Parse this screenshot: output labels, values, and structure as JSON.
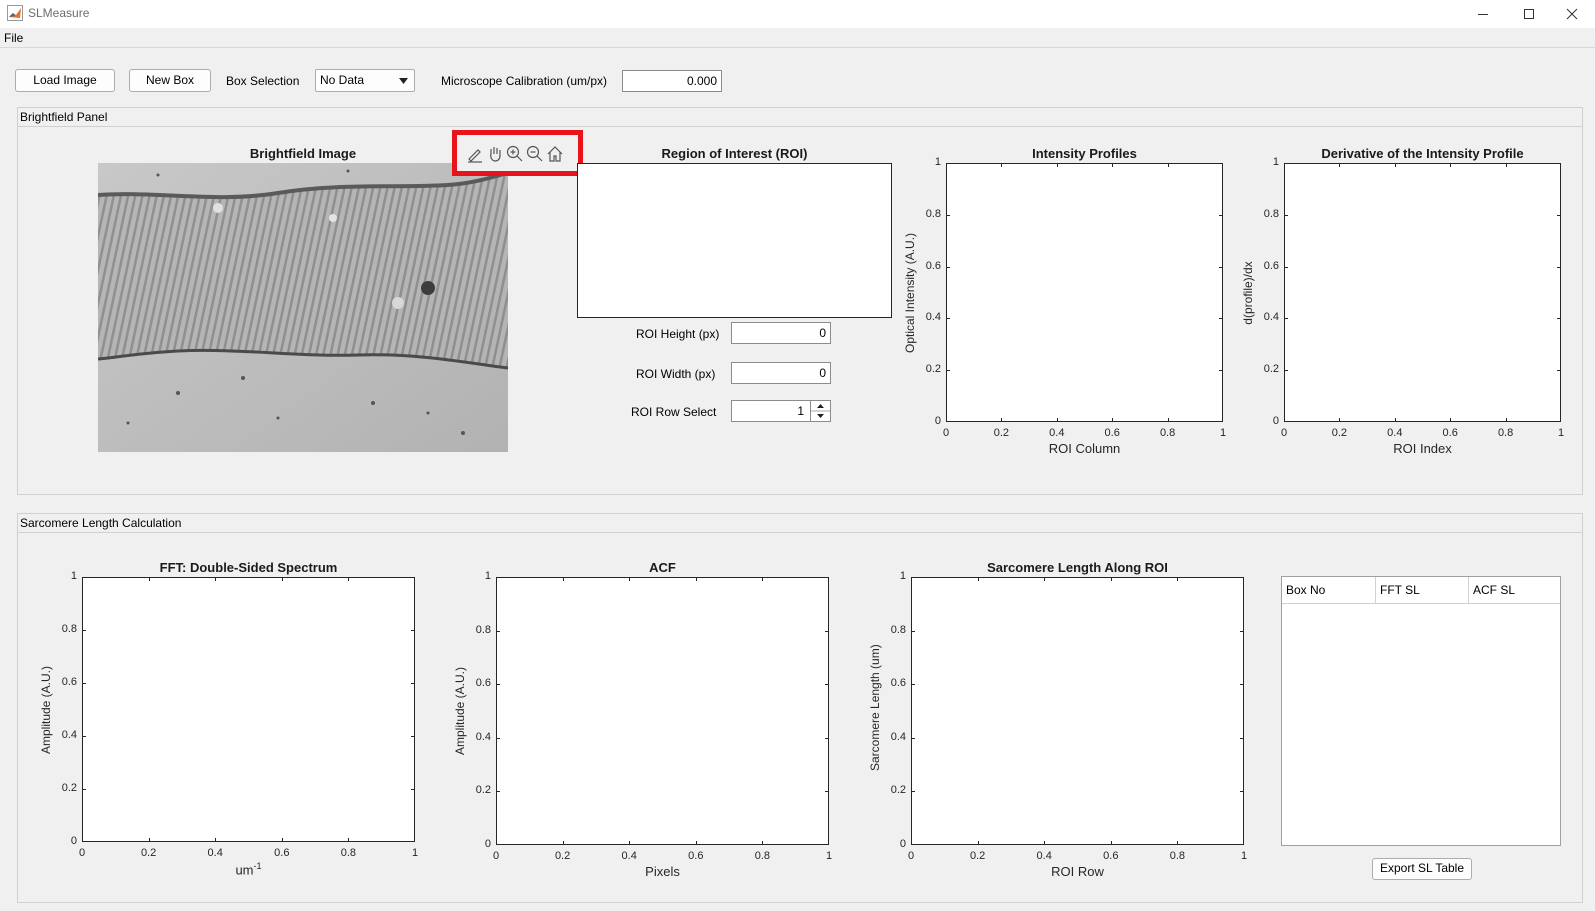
{
  "window": {
    "title": "SLMeasure"
  },
  "menu": {
    "file": "File"
  },
  "toolbar": {
    "load_image": "Load Image",
    "new_box": "New Box",
    "box_selection_label": "Box Selection",
    "box_selection_value": "No Data",
    "calibration_label": "Microscope Calibration (um/px)",
    "calibration_value": "0.000"
  },
  "brightfield_panel": {
    "title": "Brightfield Panel",
    "image_title": "Brightfield Image",
    "axes_toolbar_icons": [
      "brush-icon",
      "pan-icon",
      "zoom-in-icon",
      "zoom-out-icon",
      "home-icon"
    ],
    "roi_title": "Region of Interest (ROI)",
    "roi_height_label": "ROI Height (px)",
    "roi_height_value": "0",
    "roi_width_label": "ROI Width (px)",
    "roi_width_value": "0",
    "roi_row_label": "ROI Row Select",
    "roi_row_value": "1",
    "intensity": {
      "title": "Intensity Profiles",
      "xlabel": "ROI Column",
      "ylabel": "Optical Intensity (A.U.)"
    },
    "derivative": {
      "title": "Derivative of the Intensity Profile",
      "xlabel": "ROI Index",
      "ylabel": "d(profile)/dx"
    }
  },
  "sarcomere_panel": {
    "title": "Sarcomere Length Calculation",
    "fft": {
      "title": "FFT: Double-Sided Spectrum",
      "xlabel": "um",
      "xlabel_sup": "-1",
      "ylabel": "Amplitude (A.U.)"
    },
    "acf": {
      "title": "ACF",
      "xlabel": "Pixels",
      "ylabel": "Amplitude (A.U.)"
    },
    "sl_along": {
      "title": "Sarcomere Length Along ROI",
      "xlabel": "ROI Row",
      "ylabel": "Sarcomere Length (um)"
    },
    "table": {
      "columns": [
        "Box No",
        "FFT SL",
        "ACF SL"
      ],
      "rows": []
    },
    "export_button": "Export SL Table"
  },
  "axis_ticks": [
    "0",
    "0.2",
    "0.4",
    "0.6",
    "0.8",
    "1"
  ],
  "colors": {
    "highlight": "#e8141c",
    "axes": "#262626",
    "panel_border": "#d0d0d0"
  },
  "chart_data": [
    {
      "type": "line",
      "title": "Intensity Profiles",
      "xlabel": "ROI Column",
      "ylabel": "Optical Intensity (A.U.)",
      "xlim": [
        0,
        1
      ],
      "ylim": [
        0,
        1
      ],
      "series": []
    },
    {
      "type": "line",
      "title": "Derivative of the Intensity Profile",
      "xlabel": "ROI Index",
      "ylabel": "d(profile)/dx",
      "xlim": [
        0,
        1
      ],
      "ylim": [
        0,
        1
      ],
      "series": []
    },
    {
      "type": "line",
      "title": "FFT: Double-Sided Spectrum",
      "xlabel": "um-1",
      "ylabel": "Amplitude (A.U.)",
      "xlim": [
        0,
        1
      ],
      "ylim": [
        0,
        1
      ],
      "series": []
    },
    {
      "type": "line",
      "title": "ACF",
      "xlabel": "Pixels",
      "ylabel": "Amplitude (A.U.)",
      "xlim": [
        0,
        1
      ],
      "ylim": [
        0,
        1
      ],
      "series": []
    },
    {
      "type": "line",
      "title": "Sarcomere Length Along ROI",
      "xlabel": "ROI Row",
      "ylabel": "Sarcomere Length (um)",
      "xlim": [
        0,
        1
      ],
      "ylim": [
        0,
        1
      ],
      "series": []
    }
  ]
}
